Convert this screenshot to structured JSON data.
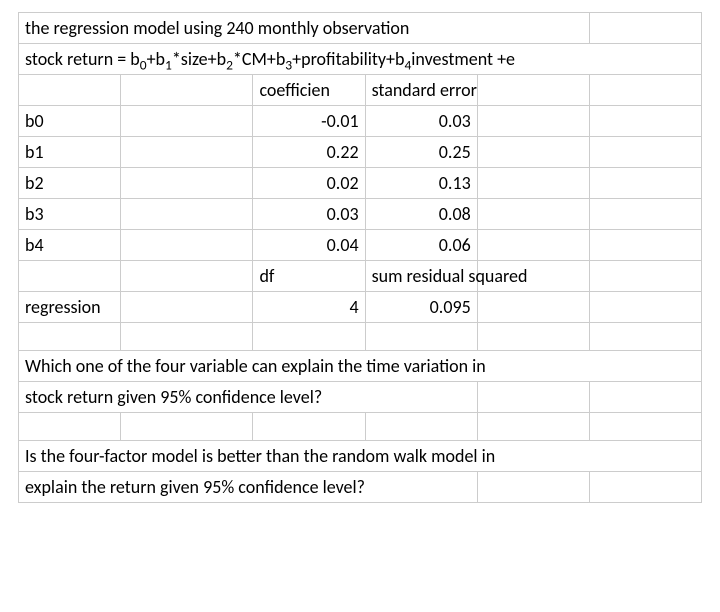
{
  "intro": {
    "line1": "the regression model using 240 monthly observation",
    "line2_html": "stock return = b<sub>0</sub>+b<sub>1</sub>*size+b<sub>2</sub>*CM+b<sub>3</sub>+profitability+b<sub>4</sub>investment +e"
  },
  "headers": {
    "coef": "coefficien",
    "stderr": "standard error",
    "df": "df",
    "resid": "sum residual squared"
  },
  "rows": [
    {
      "name": "b0",
      "coef": "-0.01",
      "se": "0.03"
    },
    {
      "name": "b1",
      "coef": "0.22",
      "se": "0.25"
    },
    {
      "name": "b2",
      "coef": "0.02",
      "se": "0.13"
    },
    {
      "name": "b3",
      "coef": "0.03",
      "se": "0.08"
    },
    {
      "name": "b4",
      "coef": "0.04",
      "se": "0.06"
    }
  ],
  "regression": {
    "label": "regression",
    "df": "4",
    "resid": "0.095"
  },
  "questions": {
    "q1a": "Which one of the four variable can explain the time variation in",
    "q1b": "stock return given 95% confidence level?",
    "q2a": "Is the four-factor model is better than the random walk model in",
    "q2b": "explain the return given 95% confidence level?"
  }
}
